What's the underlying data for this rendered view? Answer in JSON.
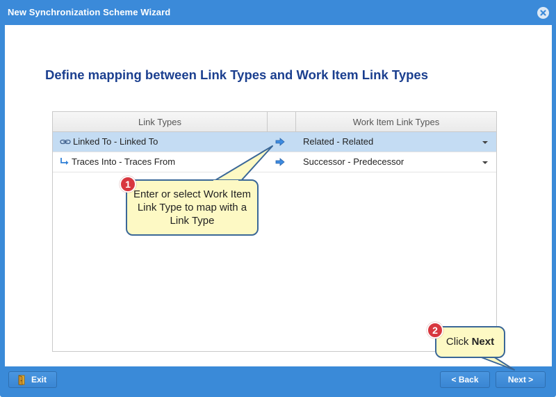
{
  "window": {
    "title": "New Synchronization Scheme Wizard"
  },
  "page": {
    "heading": "Define mapping between Link Types and Work Item Link Types"
  },
  "grid": {
    "columns": [
      "Link Types",
      "",
      "Work Item Link Types"
    ],
    "rows": [
      {
        "link_type": "Linked To - Linked To",
        "link_icon": "chain-link-icon",
        "work_item_link_type": "Related - Related",
        "selected": true
      },
      {
        "link_type": "Traces Into - Traces From",
        "link_icon": "turn-right-arrow-icon",
        "work_item_link_type": "Successor - Predecessor",
        "selected": false
      }
    ]
  },
  "callouts": {
    "c1": {
      "number": "1",
      "text": "Enter or select Work Item Link Type to map with a Link Type"
    },
    "c2": {
      "number": "2",
      "prefix": "Click",
      "bold": "Next"
    }
  },
  "buttons": {
    "exit": "Exit",
    "back": "< Back",
    "next": "Next >"
  },
  "colors": {
    "titlebar": "#3b8ad9",
    "heading": "#1b3f8f",
    "selected_row": "#c4dcf3",
    "callout_fill": "#fdf9c4",
    "badge": "#d8373f"
  }
}
